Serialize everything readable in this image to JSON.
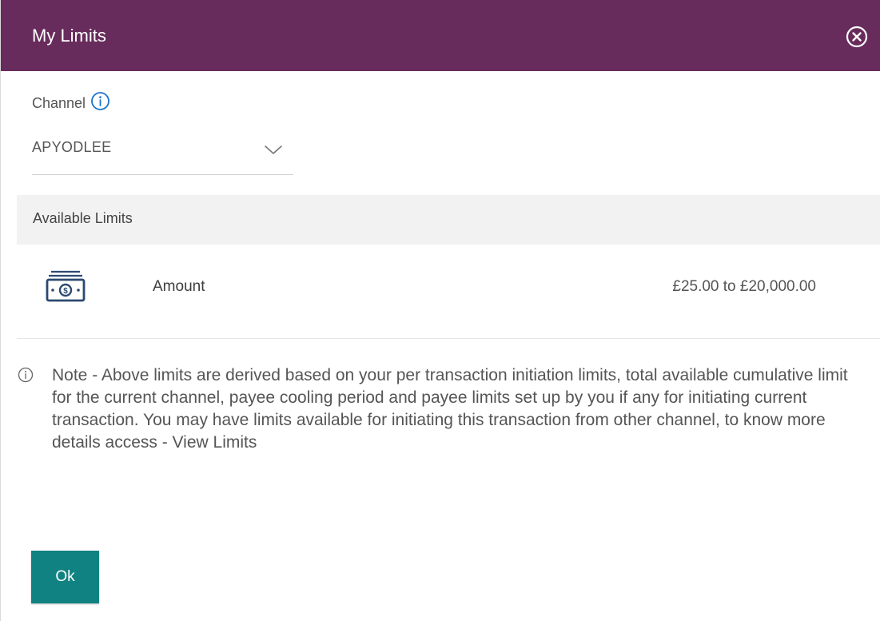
{
  "dialog": {
    "title": "My Limits",
    "close_icon": "close-circle-icon"
  },
  "channel": {
    "label": "Channel",
    "info_icon": "info-icon",
    "selected": "APYODLEE",
    "chevron_icon": "chevron-down-icon"
  },
  "limits": {
    "header": "Available Limits",
    "rows": [
      {
        "icon": "banknote-icon",
        "label": "Amount",
        "value": "£25.00 to £20,000.00"
      }
    ]
  },
  "note": {
    "icon": "info-icon",
    "text": "Note - Above limits are derived based on your  per transaction initiation limits, total available cumulative limit for the current channel, payee cooling period and payee limits set up by you if any for initiating current transaction. You may have limits available for initiating this transaction from other channel, to know more details access - View Limits"
  },
  "actions": {
    "ok_label": "Ok"
  },
  "colors": {
    "header_bg": "#682c5c",
    "accent_teal": "#118282",
    "info_blue": "#1a73c8"
  }
}
